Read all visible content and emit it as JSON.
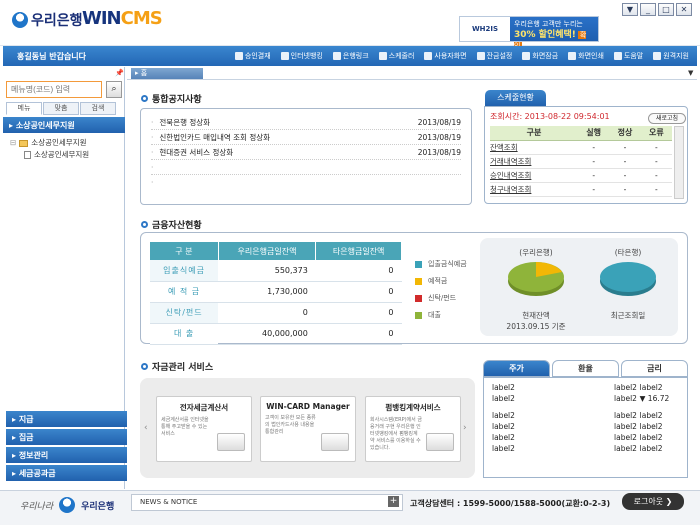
{
  "window": {
    "buttons": [
      "▼",
      "_",
      "□",
      "✕"
    ]
  },
  "brand": {
    "logo_text": "우리은행",
    "product": "WIN",
    "product_suffix": "CMS"
  },
  "banner": {
    "left_text": "WH2IS",
    "line1": "우리은행 고객만 누리는",
    "line2": "30% 할인혜택!",
    "tag": "확인"
  },
  "nav": {
    "greeting": "홍길동님 반갑습니다",
    "items": [
      "승인결재",
      "인터넷뱅킹",
      "은행링크",
      "스케줄러",
      "사용자화면",
      "잔금설정",
      "화면잠금",
      "화면인쇄",
      "도움말",
      "원격지원"
    ]
  },
  "sidebar": {
    "search_placeholder": "메뉴명(코드) 입력",
    "search_icon": "magnifier-icon",
    "tabs": [
      "메뉴",
      "맞춤",
      "검색"
    ],
    "section_top": "소상공인세무지원",
    "tree": [
      "소상공인세무지원",
      "소상공인세무지원"
    ],
    "bottom_sections": [
      "지급",
      "집금",
      "정보관리",
      "세금공과금"
    ]
  },
  "tabs": {
    "home": "홈"
  },
  "notice": {
    "title": "통합공지사항",
    "rows": [
      {
        "text": "전북은행 정상화",
        "date": "2013/08/19"
      },
      {
        "text": "신한법인카드 매입내역 조회 정상화",
        "date": "2013/08/19"
      },
      {
        "text": "현대증권 서비스 정상화",
        "date": "2013/08/19"
      },
      {
        "text": "",
        "date": ""
      },
      {
        "text": "",
        "date": ""
      }
    ]
  },
  "schedule": {
    "tab": "스케줄현황",
    "time_label": "조회시간: 2013-08-22 09:54:01",
    "refresh": "새로고침",
    "headers": [
      "구분",
      "실행",
      "정상",
      "오류"
    ],
    "rows": [
      [
        "잔액조회",
        "-",
        "-",
        "-"
      ],
      [
        "거래내역조회",
        "-",
        "-",
        "-"
      ],
      [
        "승인내역조회",
        "-",
        "-",
        "-"
      ],
      [
        "청구내역조회",
        "-",
        "-",
        "-"
      ]
    ]
  },
  "finance": {
    "title": "금융자산현황",
    "headers": [
      "구 분",
      "우리은행금일잔액",
      "타은행금일잔액"
    ],
    "rows": [
      [
        "입출식예금",
        "550,373",
        "0"
      ],
      [
        "예 적 금",
        "1,730,000",
        "0"
      ],
      [
        "신탁/펀드",
        "0",
        "0"
      ],
      [
        "대 출",
        "40,000,000",
        "0"
      ]
    ],
    "legend": [
      {
        "label": "입출금식예금",
        "color": "#3aa2b8"
      },
      {
        "label": "예적금",
        "color": "#f2b705"
      },
      {
        "label": "신탁/펀드",
        "color": "#d12b2b"
      },
      {
        "label": "대출",
        "color": "#8fb43a"
      }
    ],
    "pie_woori_label": "(우리은행)",
    "pie_other_label": "(타은행)",
    "pie_woori_caption1": "현재잔액",
    "pie_woori_caption2": "2013.09.15 기준",
    "pie_other_caption": "최근조회일",
    "colors": {
      "woori_main": "#8fb43a",
      "woori_slice": "#f2b705",
      "other": "#3aa2b8"
    }
  },
  "fund": {
    "title": "자금관리 서비스",
    "cards": [
      {
        "title": "전자세금계산서",
        "desc": "세금계산서를 인터넷을 통해 주고받을 수 있는 서비스"
      },
      {
        "title": "WIN-CARD Manager",
        "desc": "고객이 보유한 모든 종류의 법인카드사용 내용을 통합관리"
      },
      {
        "title": "펌뱅킹계약서비스",
        "desc": "회사시스템(ERP)에서 금융거래 구현 우리은행 인터넷뱅킹에서 펌뱅킹계약 서비스를 이용하실 수 있습니다."
      }
    ]
  },
  "rates": {
    "tabs": [
      "주가",
      "환율",
      "금리"
    ],
    "rows": [
      [
        "label2",
        "label2",
        "label2"
      ],
      [
        "label2",
        "label2",
        "▼ 16.72"
      ],
      null,
      [
        "label2",
        "label2",
        "label2"
      ],
      [
        "label2",
        "label2",
        "label2"
      ],
      [
        "label2",
        "label2",
        "label2"
      ],
      [
        "label2",
        "label2",
        "label2"
      ]
    ]
  },
  "footer": {
    "slogan": "우리나라",
    "logo": "우리은행",
    "news": "NEWS & NOTICE",
    "plus": "+",
    "callcenter": "고객상담센터 : 1599-5000/1588-5000(교환:0-2-3)",
    "logout": "로그아웃 ❯"
  }
}
